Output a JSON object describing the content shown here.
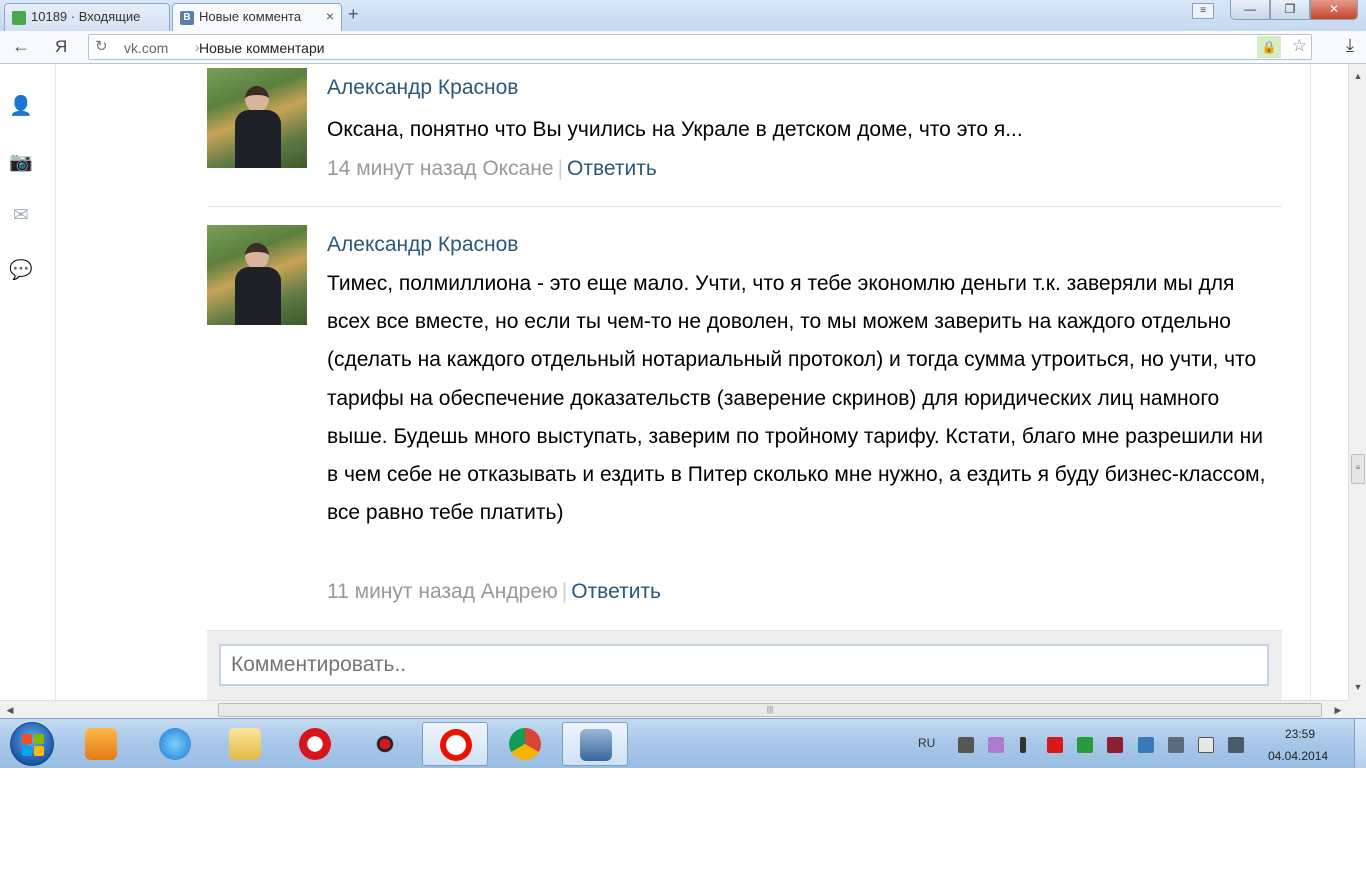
{
  "browser": {
    "tabs": [
      {
        "title": "10189 · Входящие",
        "icon": "mail-icon",
        "active": false
      },
      {
        "title": "Новые коммента",
        "icon": "vk-icon",
        "active": true
      }
    ],
    "address": {
      "domain": "vk.com",
      "separator": "›",
      "page_title": "Новые комментари"
    },
    "nav": {
      "back": "←",
      "yandex": "Я"
    }
  },
  "comments": [
    {
      "author": "Александр Краснов",
      "text": "Оксана, понятно что Вы учились на Украле в детском доме, что это я...",
      "time": "14 минут назад Оксане",
      "reply": "Ответить"
    },
    {
      "author": "Александр Краснов",
      "text": "Тимес, полмиллиона - это еще мало. Учти, что я тебе экономлю деньги т.к. заверяли мы для всех все вместе, но если ты чем-то не доволен, то мы можем заверить на каждого отдельно (сделать на каждого отдельный нотариальный протокол) и тогда сумма утроиться, но учти, что тарифы на обеспечение доказательств (заверение скринов) для юридических лиц намного выше. Будешь много выступать, заверим по тройному тарифу. Кстати, благо мне разрешили ни в чем себе не отказывать и ездить в Питер сколько мне нужно, а ездить я буду бизнес-классом, все равно тебе платить)",
      "time": "11 минут назад Андрею",
      "reply": "Ответить"
    }
  ],
  "reply_box": {
    "placeholder": "Комментировать.."
  },
  "left_nav": [
    "user-icon",
    "camera-icon",
    "mail-icon",
    "chat-icon"
  ],
  "taskbar": {
    "apps": [
      "media-player-icon",
      "internet-explorer-icon",
      "file-explorer-icon",
      "opera-icon",
      "echo-icon",
      "yandex-browser-icon",
      "chrome-icon",
      "phone-app-icon"
    ],
    "lang": "RU",
    "time": "23:59",
    "date": "04.04.2014"
  },
  "colors": {
    "link": "#2b587a",
    "meta": "#999999",
    "taskbar": "#a9c8e8"
  }
}
